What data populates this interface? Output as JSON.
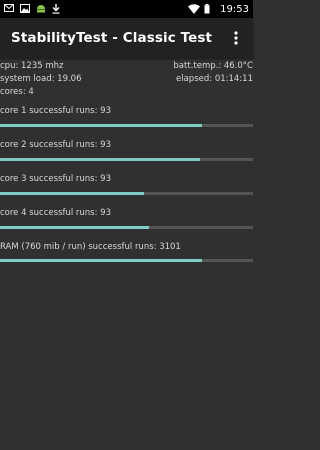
{
  "status_bar": {
    "time": "19:53",
    "icons_left": [
      "mail-icon",
      "image-icon",
      "android-icon",
      "download-icon"
    ],
    "icons_right": [
      "wifi-icon",
      "battery-icon"
    ]
  },
  "app_bar": {
    "title": "StabilityTest - Classic Test",
    "menu_icon": "overflow-menu-icon"
  },
  "stats": {
    "cpu": "cpu: 1235 mhz",
    "batt_temp": "batt.temp.: 46.0°C",
    "system_load": "system load: 19.06",
    "elapsed": "elapsed: 01:14:11",
    "cores": "cores: 4"
  },
  "tests": [
    {
      "label": "core 1 successful runs: 93",
      "progress": 0.8
    },
    {
      "label": "core 2 successful runs: 93",
      "progress": 0.79
    },
    {
      "label": "core 3 successful runs: 93",
      "progress": 0.57
    },
    {
      "label": "core 4 successful runs: 93",
      "progress": 0.59
    },
    {
      "label": "RAM (760 mib / run) successful runs: 3101",
      "progress": 0.8
    }
  ],
  "colors": {
    "accent": "#80cbc4",
    "track": "#555555",
    "background": "#303030",
    "app_bar": "#222222"
  }
}
